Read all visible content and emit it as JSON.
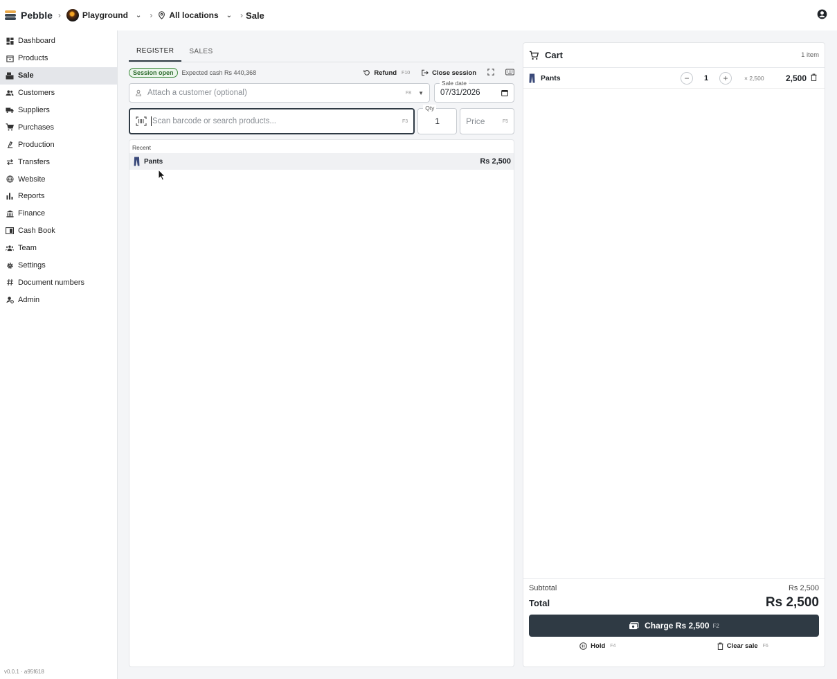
{
  "topbar": {
    "brand": "Pebble",
    "workspace": "Playground",
    "location": "All locations",
    "page": "Sale"
  },
  "sidebar": {
    "items": [
      {
        "label": "Dashboard",
        "icon": "grid-icon"
      },
      {
        "label": "Products",
        "icon": "box-icon"
      },
      {
        "label": "Sale",
        "icon": "register-icon",
        "active": true
      },
      {
        "label": "Customers",
        "icon": "people-icon"
      },
      {
        "label": "Suppliers",
        "icon": "truck-icon"
      },
      {
        "label": "Purchases",
        "icon": "cart-icon"
      },
      {
        "label": "Production",
        "icon": "precision-icon"
      },
      {
        "label": "Transfers",
        "icon": "swap-icon"
      },
      {
        "label": "Website",
        "icon": "globe-icon"
      },
      {
        "label": "Reports",
        "icon": "bar-chart-icon"
      },
      {
        "label": "Finance",
        "icon": "bank-icon"
      },
      {
        "label": "Cash Book",
        "icon": "book-icon"
      },
      {
        "label": "Team",
        "icon": "team-icon"
      },
      {
        "label": "Settings",
        "icon": "gear-icon"
      },
      {
        "label": "Document numbers",
        "icon": "hash-icon"
      },
      {
        "label": "Admin",
        "icon": "admin-icon"
      }
    ],
    "version": "v0.0.1 · a95f618"
  },
  "tabs": [
    "REGISTER",
    "SALES"
  ],
  "session": {
    "badge": "Session open",
    "expected": "Expected cash Rs 440,368",
    "refund_label": "Refund",
    "refund_key": "F10",
    "close_label": "Close session"
  },
  "customer": {
    "placeholder": "Attach a customer (optional)",
    "key": "F8"
  },
  "sale_date": {
    "label": "Sale date",
    "value": "07/31/2026"
  },
  "search": {
    "placeholder": "Scan barcode or search products...",
    "key": "F3"
  },
  "qty": {
    "label": "Qty",
    "value": "1"
  },
  "price": {
    "placeholder": "Price",
    "key": "F5"
  },
  "recent": {
    "title": "Recent",
    "items": [
      {
        "name": "Pants",
        "price": "Rs 2,500"
      }
    ]
  },
  "cart": {
    "title": "Cart",
    "count": "1 item",
    "lines": [
      {
        "name": "Pants",
        "qty": "1",
        "unit": "× 2,500",
        "total": "2,500"
      }
    ],
    "subtotal_label": "Subtotal",
    "subtotal": "Rs 2,500",
    "total_label": "Total",
    "total": "Rs 2,500",
    "charge_label": "Charge Rs 2,500",
    "charge_key": "F2",
    "hold_label": "Hold",
    "hold_key": "F4",
    "clear_label": "Clear sale",
    "clear_key": "F6"
  },
  "colors": {
    "accent": "#2f3a44",
    "session_green": "#3d8a3d",
    "active_nav": "#e4e6ea"
  }
}
